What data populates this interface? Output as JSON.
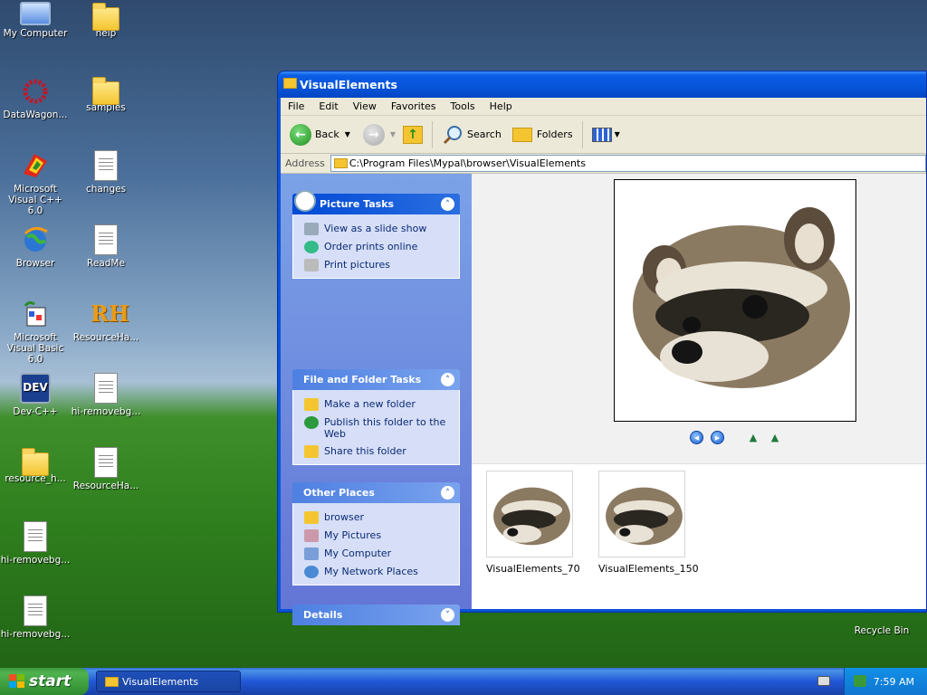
{
  "desktop": {
    "icons": [
      {
        "label": "My Computer"
      },
      {
        "label": "help"
      },
      {
        "label": "DataWagon..."
      },
      {
        "label": "samples"
      },
      {
        "label": "Microsoft Visual C++ 6.0"
      },
      {
        "label": "changes"
      },
      {
        "label": "Browser"
      },
      {
        "label": "ReadMe"
      },
      {
        "label": "Microsoft Visual Basic 6.0"
      },
      {
        "label": "ResourceHa..."
      },
      {
        "label": "Dev-C++"
      },
      {
        "label": "hi-removebg..."
      },
      {
        "label": "resource_h..."
      },
      {
        "label": "ResourceHa..."
      },
      {
        "label": "hi-removebg..."
      },
      {
        "label": "hi-removebg..."
      },
      {
        "label": "Recycle Bin"
      }
    ],
    "rh_text": "RH",
    "dev_text": "DEV"
  },
  "window": {
    "title": "VisualElements",
    "menu": [
      "File",
      "Edit",
      "View",
      "Favorites",
      "Tools",
      "Help"
    ],
    "toolbar": {
      "back": "Back",
      "search": "Search",
      "folders": "Folders"
    },
    "address": {
      "label": "Address",
      "value": "C:\\Program Files\\Mypal\\browser\\VisualElements"
    }
  },
  "tasks": {
    "picture_tasks": {
      "title": "Picture Tasks",
      "items": [
        "View as a slide show",
        "Order prints online",
        "Print pictures"
      ]
    },
    "file_folder_tasks": {
      "title": "File and Folder Tasks",
      "items": [
        "Make a new folder",
        "Publish this folder to the Web",
        "Share this folder"
      ]
    },
    "other_places": {
      "title": "Other Places",
      "items": [
        "browser",
        "My Pictures",
        "My Computer",
        "My Network Places"
      ]
    },
    "details": {
      "title": "Details"
    }
  },
  "files": [
    {
      "name": "VisualElements_70"
    },
    {
      "name": "VisualElements_150"
    }
  ],
  "taskbar": {
    "start_label": "start",
    "task_title": "VisualElements",
    "clock": "7:59 AM"
  },
  "colors": {
    "title_blue": "#0654d9",
    "start_green": "#3c9a3c",
    "panel_text": "#0c2a75"
  }
}
